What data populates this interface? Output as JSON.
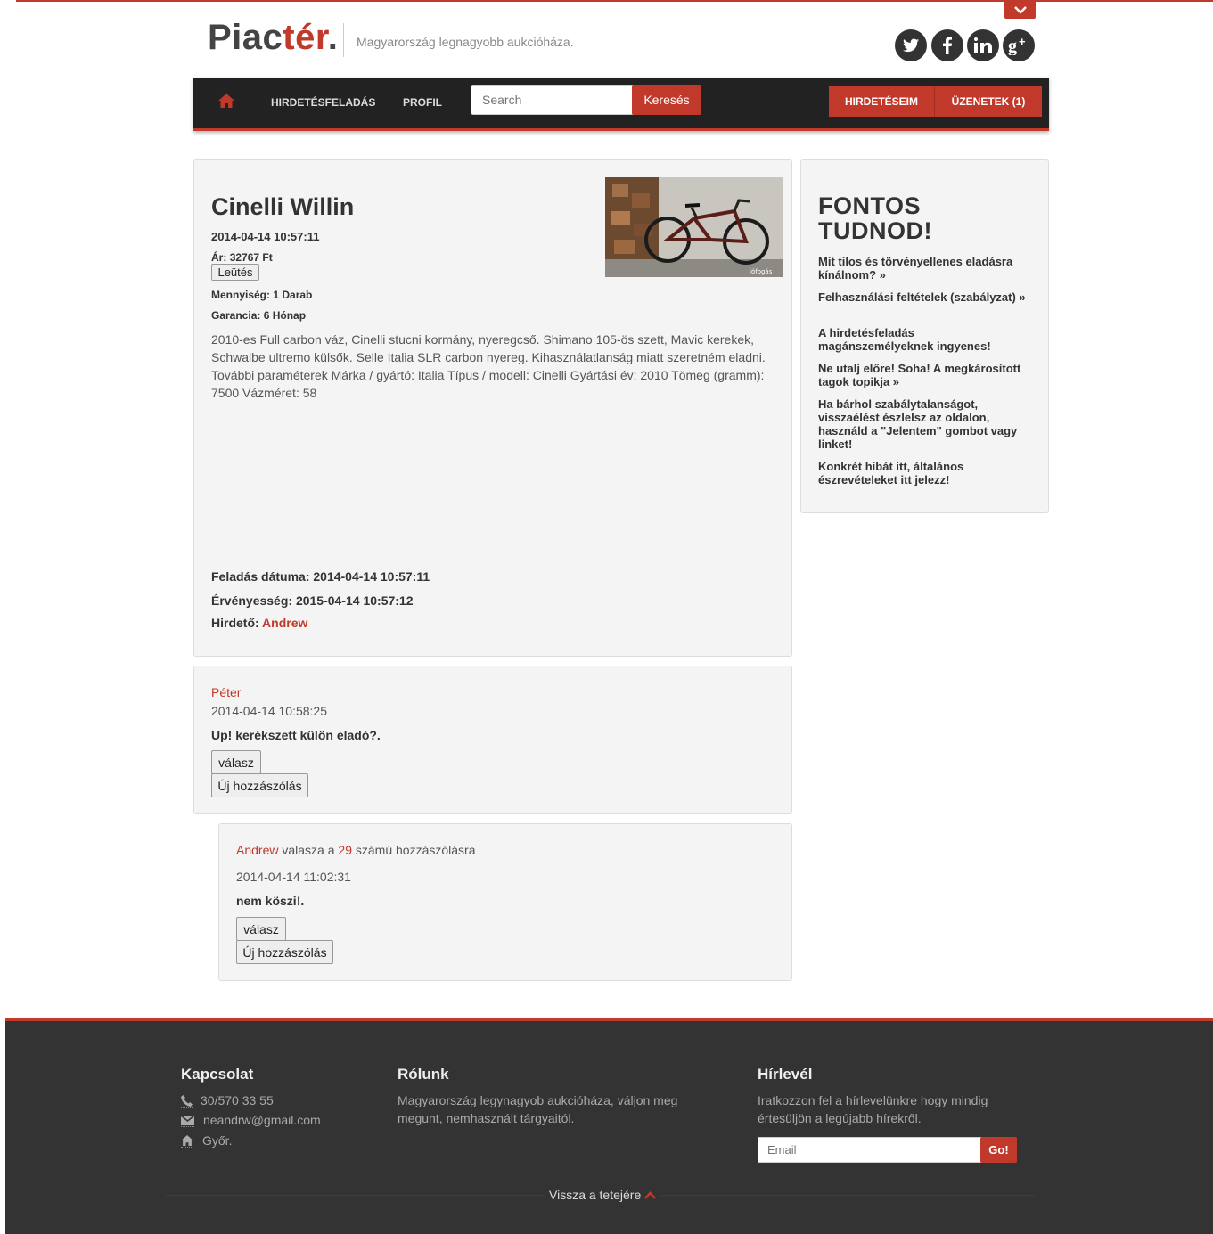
{
  "header": {
    "logo_main": "Piac",
    "logo_accent": "tér",
    "logo_dot": ".",
    "tagline": "Magyarország legnagyobb aukcióháza.",
    "social": [
      "twitter-icon",
      "facebook-icon",
      "linkedin-icon",
      "google-plus-icon"
    ]
  },
  "nav": {
    "post_ad": "HIRDETÉSFELADÁS",
    "profile": "PROFIL",
    "search_placeholder": "Search",
    "search_button": "Keresés",
    "my_ads": "HIRDETÉSEIM",
    "messages": "ÜZENETEK",
    "messages_count": "(1)"
  },
  "listing": {
    "title": "Cinelli Willin",
    "datetime": "2014-04-14 10:57:11",
    "price_label": "Ár:",
    "price": "32767 Ft",
    "bid_button": "Leütés",
    "quantity_label": "Mennyiség:",
    "quantity": "1 Darab",
    "warranty_label": "Garancia:",
    "warranty": "6 Hónap",
    "description": "2010-es Full carbon váz, Cinelli stucni kormány, nyeregcső. Shimano 105-ös szett, Mavic kerekek, Schwalbe ultremo külsők. Selle Italia SLR carbon nyereg. Kihasználatlanság miatt szeretném eladni. További paraméterek Márka / gyártó: Italia Típus / modell: Cinelli Gyártási év: 2010 Tömeg (gramm): 7500 Vázméret: 58",
    "posted_label": "Feladás dátuma:",
    "posted": "2014-04-14 10:57:11",
    "valid_label": "Érvényesség:",
    "valid": "2015-04-14 10:57:12",
    "advertiser_label": "Hirdető:",
    "advertiser": "Andrew",
    "image_watermark": "jófogás"
  },
  "sidebar": {
    "title_line1": "FONTOS",
    "title_line2": "TUDNOD!",
    "items": [
      "Mit tilos és törvényellenes eladásra kínálnom? »",
      "Felhasználási feltételek (szabályzat) »",
      "A hirdetésfeladás magánszemélyeknek ingyenes!",
      "Ne utalj előre! Soha! A megkárosított tagok topikja »",
      "Ha bárhol szabálytalanságot, visszaélést észlelsz az oldalon, használd a \"Jelentem\" gombot vagy linket!",
      "Konkrét hibát itt, általános észrevételeket itt jelezz!"
    ]
  },
  "comments": [
    {
      "author": "Péter",
      "date": "2014-04-14 10:58:25",
      "text": "Up! kerékszett külön eladó?.",
      "reply_button": "válasz",
      "new_button": "Új hozzászólás"
    },
    {
      "author": "Andrew",
      "reply_text": "valasza a",
      "reply_ref": "29",
      "reply_suffix": "számú hozzászólásra",
      "date": "2014-04-14 11:02:31",
      "text": "nem köszi!.",
      "reply_button": "válasz",
      "new_button": "Új hozzászólás"
    }
  ],
  "footer": {
    "contact_title": "Kapcsolat",
    "phone": "30/570 33 55",
    "email": "neandrw@gmail.com",
    "city": "Győr.",
    "about_title": "Rólunk",
    "about_text": "Magyarország legynagyob aukcióháza, váljon meg megunt, nemhasznált tárgyaitól.",
    "newsletter_title": "Hírlevél",
    "newsletter_text": "Iratkozzon fel a hírlevelünkre hogy mindig értesüljön a legújabb hírekről.",
    "email_placeholder": "Email",
    "go_button": "Go!",
    "back_to_top": "Vissza a tetejére"
  },
  "colors": {
    "accent": "#c0392b",
    "nav_bg": "#222222",
    "footer_bg": "#333333",
    "panel_bg": "#f4f4f4"
  }
}
